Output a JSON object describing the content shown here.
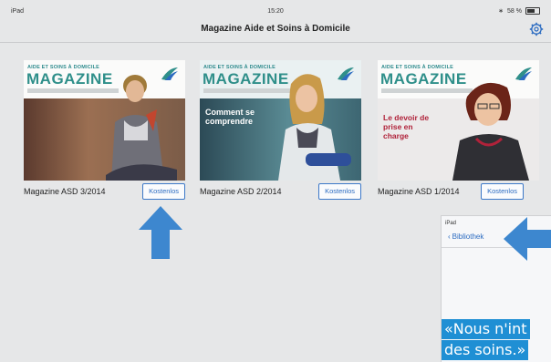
{
  "status": {
    "device": "iPad",
    "time": "15:20",
    "battery": "58 %",
    "battery_level": 0.58
  },
  "navbar": {
    "title": "Magazine Aide et Soins à Domicile"
  },
  "settings_icon": "gear-icon",
  "magazines": [
    {
      "label": "Magazine ASD 3/2014",
      "button": "Kostenlos",
      "cover_aide": "AIDE ET SOINS À DOMICILE",
      "cover_magazine": "MAGAZINE",
      "cover_headline": "",
      "accent": "#c2462f"
    },
    {
      "label": "Magazine ASD 2/2014",
      "button": "Kostenlos",
      "cover_aide": "AIDE ET SOINS À DOMICILE",
      "cover_magazine": "MAGAZINE",
      "cover_headline": "Comment se comprendre",
      "accent": "#2f8f8a"
    },
    {
      "label": "Magazine ASD 1/2014",
      "button": "Kostenlos",
      "cover_aide": "AIDE ET SOINS À DOMICILE",
      "cover_magazine": "MAGAZINE",
      "cover_headline": "Le devoir de prise en charge",
      "accent": "#b0223a"
    }
  ],
  "inset": {
    "device": "iPad",
    "back_label": "Bibliothek",
    "quote_line1": "«Nous n'int",
    "quote_line2": "des soins.»"
  },
  "colors": {
    "accent_blue": "#2b6bc1",
    "arrow_blue": "#3d87cf",
    "quote_blue": "#1f8fd4"
  }
}
